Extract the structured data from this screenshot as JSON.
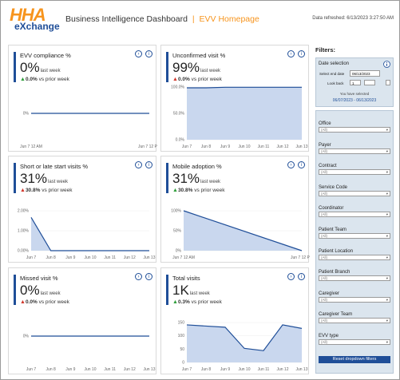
{
  "header": {
    "logo_top": "HHA",
    "logo_bottom": "eXchange",
    "title": "Business Intelligence Dashboard",
    "separator": "|",
    "home": "EVV Homepage",
    "refreshed": "Data refreshed: 6/13/2023 3:27:50 AM"
  },
  "cards": [
    {
      "title": "EVV compliance %",
      "value": "0%",
      "period": "last week",
      "delta_dir": "up",
      "delta": "0.0%",
      "delta_text": "vs prior week"
    },
    {
      "title": "Unconfirmed visit %",
      "value": "99%",
      "period": "last week",
      "delta_dir": "up-red",
      "delta": "0.0%",
      "delta_text": "vs prior week"
    },
    {
      "title": "Short or late start visits %",
      "value": "31%",
      "period": "last week",
      "delta_dir": "up-red",
      "delta": "30.8%",
      "delta_text": "vs prior week"
    },
    {
      "title": "Mobile adoption %",
      "value": "31%",
      "period": "last week",
      "delta_dir": "up",
      "delta": "30.8%",
      "delta_text": "vs prior week"
    },
    {
      "title": "Missed visit %",
      "value": "0%",
      "period": "last week",
      "delta_dir": "up-red",
      "delta": "0.0%",
      "delta_text": "vs prior week"
    },
    {
      "title": "Total visits",
      "value": "1K",
      "period": "last week",
      "delta_dir": "up",
      "delta": "0.3%",
      "delta_text": "vs prior week"
    }
  ],
  "colors": {
    "accent": "#1f4e98",
    "orange": "#f7941d",
    "green": "#2e9e3a",
    "red": "#d1372b",
    "area": "#c9d7ee"
  },
  "chart_data": [
    {
      "type": "line",
      "x": [
        "Jun 7 12 AM",
        "Jun 7 12 PM"
      ],
      "series": [
        {
          "values": [
            0,
            0
          ]
        }
      ],
      "yticks": [
        "0%"
      ]
    },
    {
      "type": "area",
      "x": [
        "Jun 7",
        "Jun 8",
        "Jun 9",
        "Jun 10",
        "Jun 11",
        "Jun 12",
        "Jun 13"
      ],
      "series": [
        {
          "values": [
            98.5,
            98.5,
            99.5,
            99.5,
            99.5,
            99.5,
            99.5
          ]
        }
      ],
      "yticks": [
        "100.0%",
        "50.0%",
        "0.0%"
      ],
      "ylim": [
        0,
        100
      ]
    },
    {
      "type": "area",
      "x": [
        "Jun 7",
        "Jun 8",
        "Jun 9",
        "Jun 10",
        "Jun 11",
        "Jun 12",
        "Jun 13"
      ],
      "series": [
        {
          "values": [
            2.0,
            0,
            0,
            0,
            0,
            0,
            0
          ]
        }
      ],
      "yticks": [
        "2.00%",
        "1.00%",
        "0.00%"
      ],
      "ylim": [
        0,
        2.4
      ]
    },
    {
      "type": "area",
      "x": [
        "Jun 7 12 AM",
        "Jun 7 12 PM"
      ],
      "series": [
        {
          "values": [
            100,
            0
          ]
        }
      ],
      "yticks": [
        "100%",
        "50%",
        "0%"
      ],
      "ylim": [
        0,
        100
      ]
    },
    {
      "type": "line",
      "x": [
        "Jun 7",
        "Jun 8",
        "Jun 9",
        "Jun 10",
        "Jun 11",
        "Jun 12",
        "Jun 13"
      ],
      "series": [
        {
          "values": [
            0,
            0,
            0,
            0,
            0,
            0,
            0
          ]
        }
      ],
      "yticks": [
        "0%"
      ]
    },
    {
      "type": "area",
      "x": [
        "Jun 7",
        "Jun 8",
        "Jun 9",
        "Jun 10",
        "Jun 11",
        "Jun 12",
        "Jun 13"
      ],
      "series": [
        {
          "values": [
            160,
            155,
            150,
            60,
            50,
            160,
            145
          ]
        }
      ],
      "yticks": [
        "150",
        "100",
        "50",
        "0"
      ],
      "ylim": [
        0,
        170
      ]
    }
  ],
  "filters": {
    "title": "Filters:",
    "date_selection": "Date selection",
    "select_end_label": "Select end date",
    "select_end_value": "06/13/2023",
    "look_back_label": "Look back",
    "look_back_value": "1",
    "look_back_unit": "",
    "you_selected": "You have selected",
    "range": "06/07/2023 - 06/13/2023",
    "groups": [
      {
        "label": "Office",
        "value": "(All)"
      },
      {
        "label": "Payer",
        "value": "(All)"
      },
      {
        "label": "Contract",
        "value": "(All)"
      },
      {
        "label": "Service Code",
        "value": "(All)"
      },
      {
        "label": "Coordinator",
        "value": "(All)"
      },
      {
        "label": "Patient Team",
        "value": "(All)"
      },
      {
        "label": "Patient Location",
        "value": "(All)"
      },
      {
        "label": "Patient Branch",
        "value": "(All)"
      },
      {
        "label": "Caregiver",
        "value": "(All)"
      },
      {
        "label": "Caregiver Team",
        "value": "(All)"
      },
      {
        "label": "EVV type",
        "value": "(All)"
      }
    ],
    "reset": "Reset dropdown filters"
  }
}
